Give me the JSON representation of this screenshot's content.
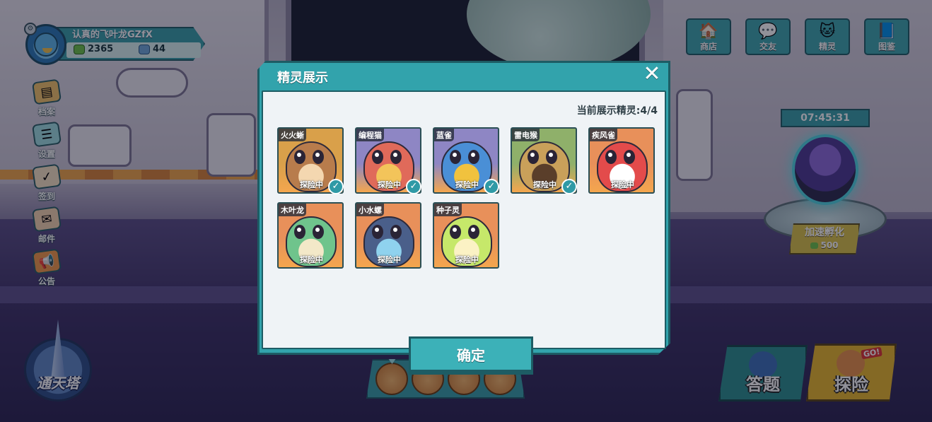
{
  "profile": {
    "name": "认真的飞叶龙GZfX",
    "coins": "2365",
    "gems": "44"
  },
  "left_menu": [
    {
      "label": "档案",
      "icon": "file-icon"
    },
    {
      "label": "设置",
      "icon": "settings-icon"
    },
    {
      "label": "签到",
      "icon": "calendar-icon"
    },
    {
      "label": "邮件",
      "icon": "mail-icon"
    },
    {
      "label": "公告",
      "icon": "megaphone-icon"
    }
  ],
  "top_menu": [
    {
      "label": "商店",
      "icon": "shop-icon"
    },
    {
      "label": "交友",
      "icon": "chat-icon"
    },
    {
      "label": "精灵",
      "icon": "cat-icon"
    },
    {
      "label": "图鉴",
      "icon": "book-icon"
    }
  ],
  "incubator": {
    "timer": "07:45:31",
    "speed_label": "加速孵化",
    "cost": "500"
  },
  "tower": {
    "label": "通天塔"
  },
  "bottom_buttons": {
    "quiz": "答题",
    "explore": "探险",
    "go_tag": "GO!"
  },
  "modal": {
    "title": "精灵展示",
    "count_text": "当前展示精灵:4/4",
    "confirm_label": "确定",
    "cards": [
      {
        "name": "火火蜥",
        "status": "探险中",
        "checked": true,
        "bg": "#d9a04a",
        "body": "#b87c4c",
        "accent": "#f4d7b0"
      },
      {
        "name": "编程猫",
        "status": "探险中",
        "checked": true,
        "bg": "#8e86c4",
        "body": "#e06a5a",
        "accent": "#f3c45a"
      },
      {
        "name": "蓝雀",
        "status": "探险中",
        "checked": true,
        "bg": "#8e86c4",
        "body": "#4a8fd6",
        "accent": "#f1c23e"
      },
      {
        "name": "雷电猴",
        "status": "探险中",
        "checked": true,
        "bg": "#8fb06a",
        "body": "#c9a05a",
        "accent": "#5a3e2a"
      },
      {
        "name": "疾风雀",
        "status": "探险中",
        "checked": false,
        "bg": "#e8905a",
        "body": "#e34b4b",
        "accent": "#ffffff"
      },
      {
        "name": "木叶龙",
        "status": "探险中",
        "checked": false,
        "bg": "#e8905a",
        "body": "#6fc48c",
        "accent": "#f3e8c8"
      },
      {
        "name": "小水螺",
        "status": "探险中",
        "checked": false,
        "bg": "#e8905a",
        "body": "#4a5f8a",
        "accent": "#8fd2ee"
      },
      {
        "name": "种子灵",
        "status": "探险中",
        "checked": false,
        "bg": "#e8905a",
        "body": "#c6e86a",
        "accent": "#fbf2c4"
      }
    ]
  }
}
